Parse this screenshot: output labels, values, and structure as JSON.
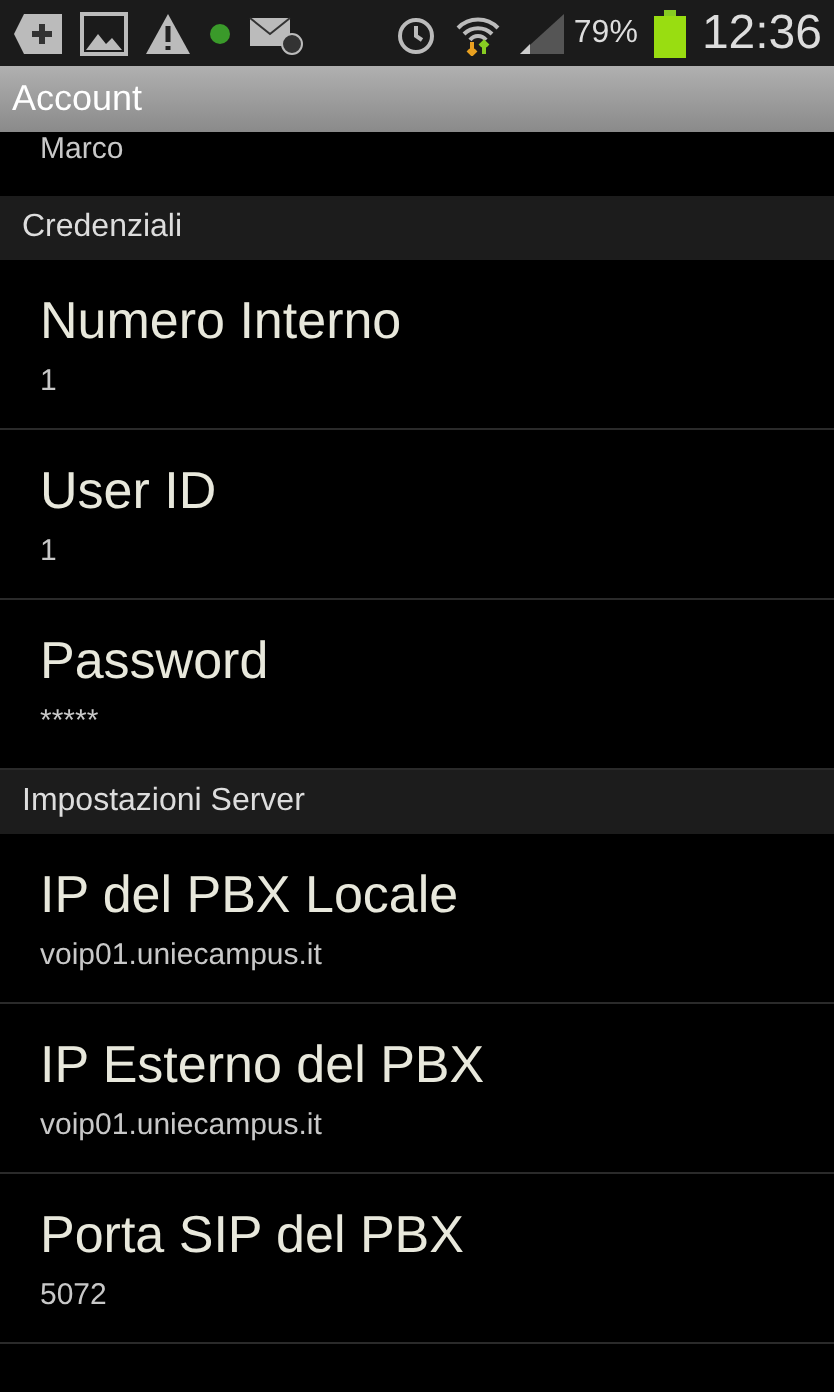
{
  "status_bar": {
    "battery": "79%",
    "time": "12:36"
  },
  "title_bar": {
    "title": "Account"
  },
  "partial_item": {
    "summary": "Marco"
  },
  "sections": [
    {
      "header": "Credenziali",
      "items": [
        {
          "title": "Numero Interno",
          "summary": "1"
        },
        {
          "title": "User ID",
          "summary": "1"
        },
        {
          "title": "Password",
          "summary": "*****"
        }
      ]
    },
    {
      "header": "Impostazioni Server",
      "items": [
        {
          "title": "IP del PBX Locale",
          "summary": "voip01.uniecampus.it"
        },
        {
          "title": "IP Esterno del PBX",
          "summary": "voip01.uniecampus.it"
        },
        {
          "title": "Porta SIP del PBX",
          "summary": "5072"
        }
      ]
    }
  ]
}
